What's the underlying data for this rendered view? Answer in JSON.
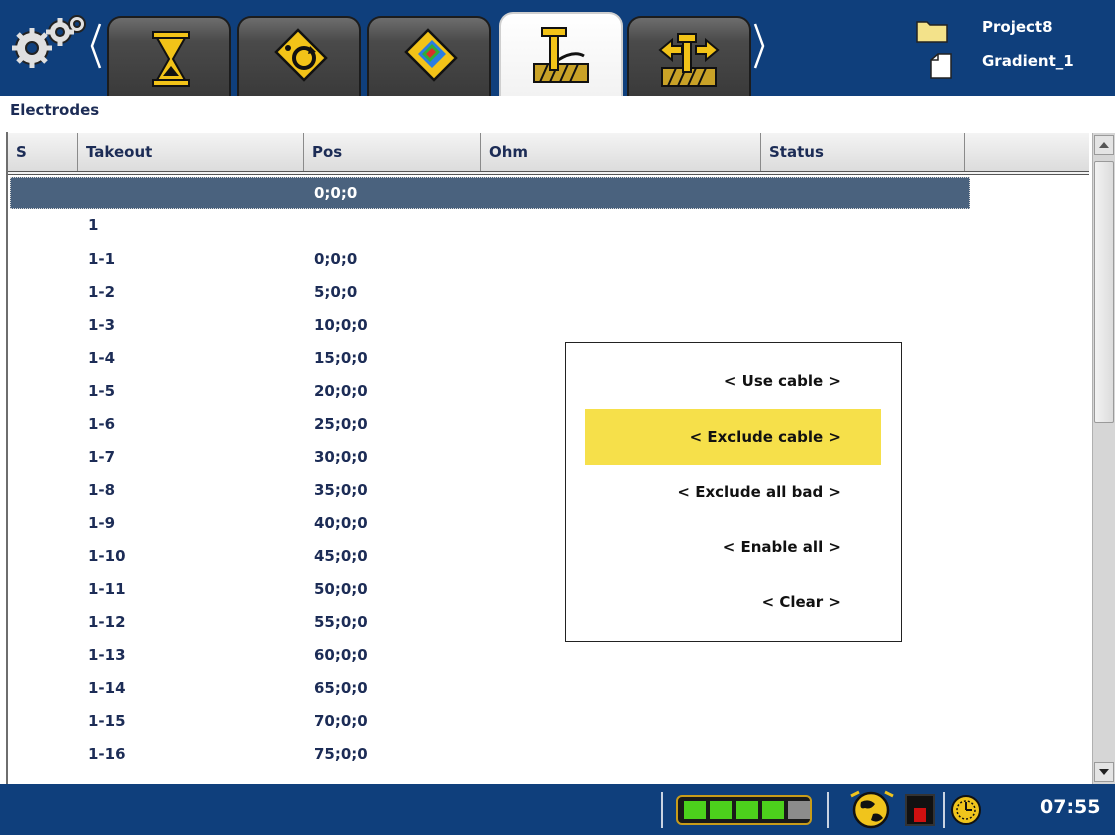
{
  "toolbar": {
    "tabs": [
      {
        "icon": "hourglass-icon",
        "active": false
      },
      {
        "icon": "refresh-tag-icon",
        "active": false
      },
      {
        "icon": "color-map-tag-icon",
        "active": false
      },
      {
        "icon": "electrode-tool-icon",
        "active": true
      },
      {
        "icon": "cable-arrows-icon",
        "active": false
      }
    ]
  },
  "project": {
    "folder": "Project8",
    "file": "Gradient_1"
  },
  "section": {
    "title": "Electrodes"
  },
  "table": {
    "columns": [
      "S",
      "Takeout",
      "Pos",
      "Ohm",
      "Status"
    ],
    "selected_row": {
      "s": "",
      "takeout": "",
      "pos": "0;0;0",
      "ohm": "",
      "status": ""
    },
    "rows": [
      {
        "takeout": "1",
        "pos": ""
      },
      {
        "takeout": "1-1",
        "pos": "0;0;0"
      },
      {
        "takeout": "1-2",
        "pos": "5;0;0"
      },
      {
        "takeout": "1-3",
        "pos": "10;0;0"
      },
      {
        "takeout": "1-4",
        "pos": "15;0;0"
      },
      {
        "takeout": "1-5",
        "pos": "20;0;0"
      },
      {
        "takeout": "1-6",
        "pos": "25;0;0"
      },
      {
        "takeout": "1-7",
        "pos": "30;0;0"
      },
      {
        "takeout": "1-8",
        "pos": "35;0;0"
      },
      {
        "takeout": "1-9",
        "pos": "40;0;0"
      },
      {
        "takeout": "1-10",
        "pos": "45;0;0"
      },
      {
        "takeout": "1-11",
        "pos": "50;0;0"
      },
      {
        "takeout": "1-12",
        "pos": "55;0;0"
      },
      {
        "takeout": "1-13",
        "pos": "60;0;0"
      },
      {
        "takeout": "1-14",
        "pos": "65;0;0"
      },
      {
        "takeout": "1-15",
        "pos": "70;0;0"
      },
      {
        "takeout": "1-16",
        "pos": "75;0;0"
      }
    ]
  },
  "menu": {
    "items": [
      {
        "label": "< Use cable >",
        "highlighted": false
      },
      {
        "label": "< Exclude cable >",
        "highlighted": true
      },
      {
        "label": "< Exclude all bad >",
        "highlighted": false
      },
      {
        "label": "< Enable all >",
        "highlighted": false
      },
      {
        "label": "< Clear >",
        "highlighted": false
      }
    ]
  },
  "status": {
    "battery_level": 0.8,
    "time": "07:55"
  },
  "colors": {
    "bar_blue": "#0f3f7c",
    "selected_row": "#4a627e",
    "menu_highlight": "#f6e04a",
    "text_navy": "#1c2c56"
  }
}
